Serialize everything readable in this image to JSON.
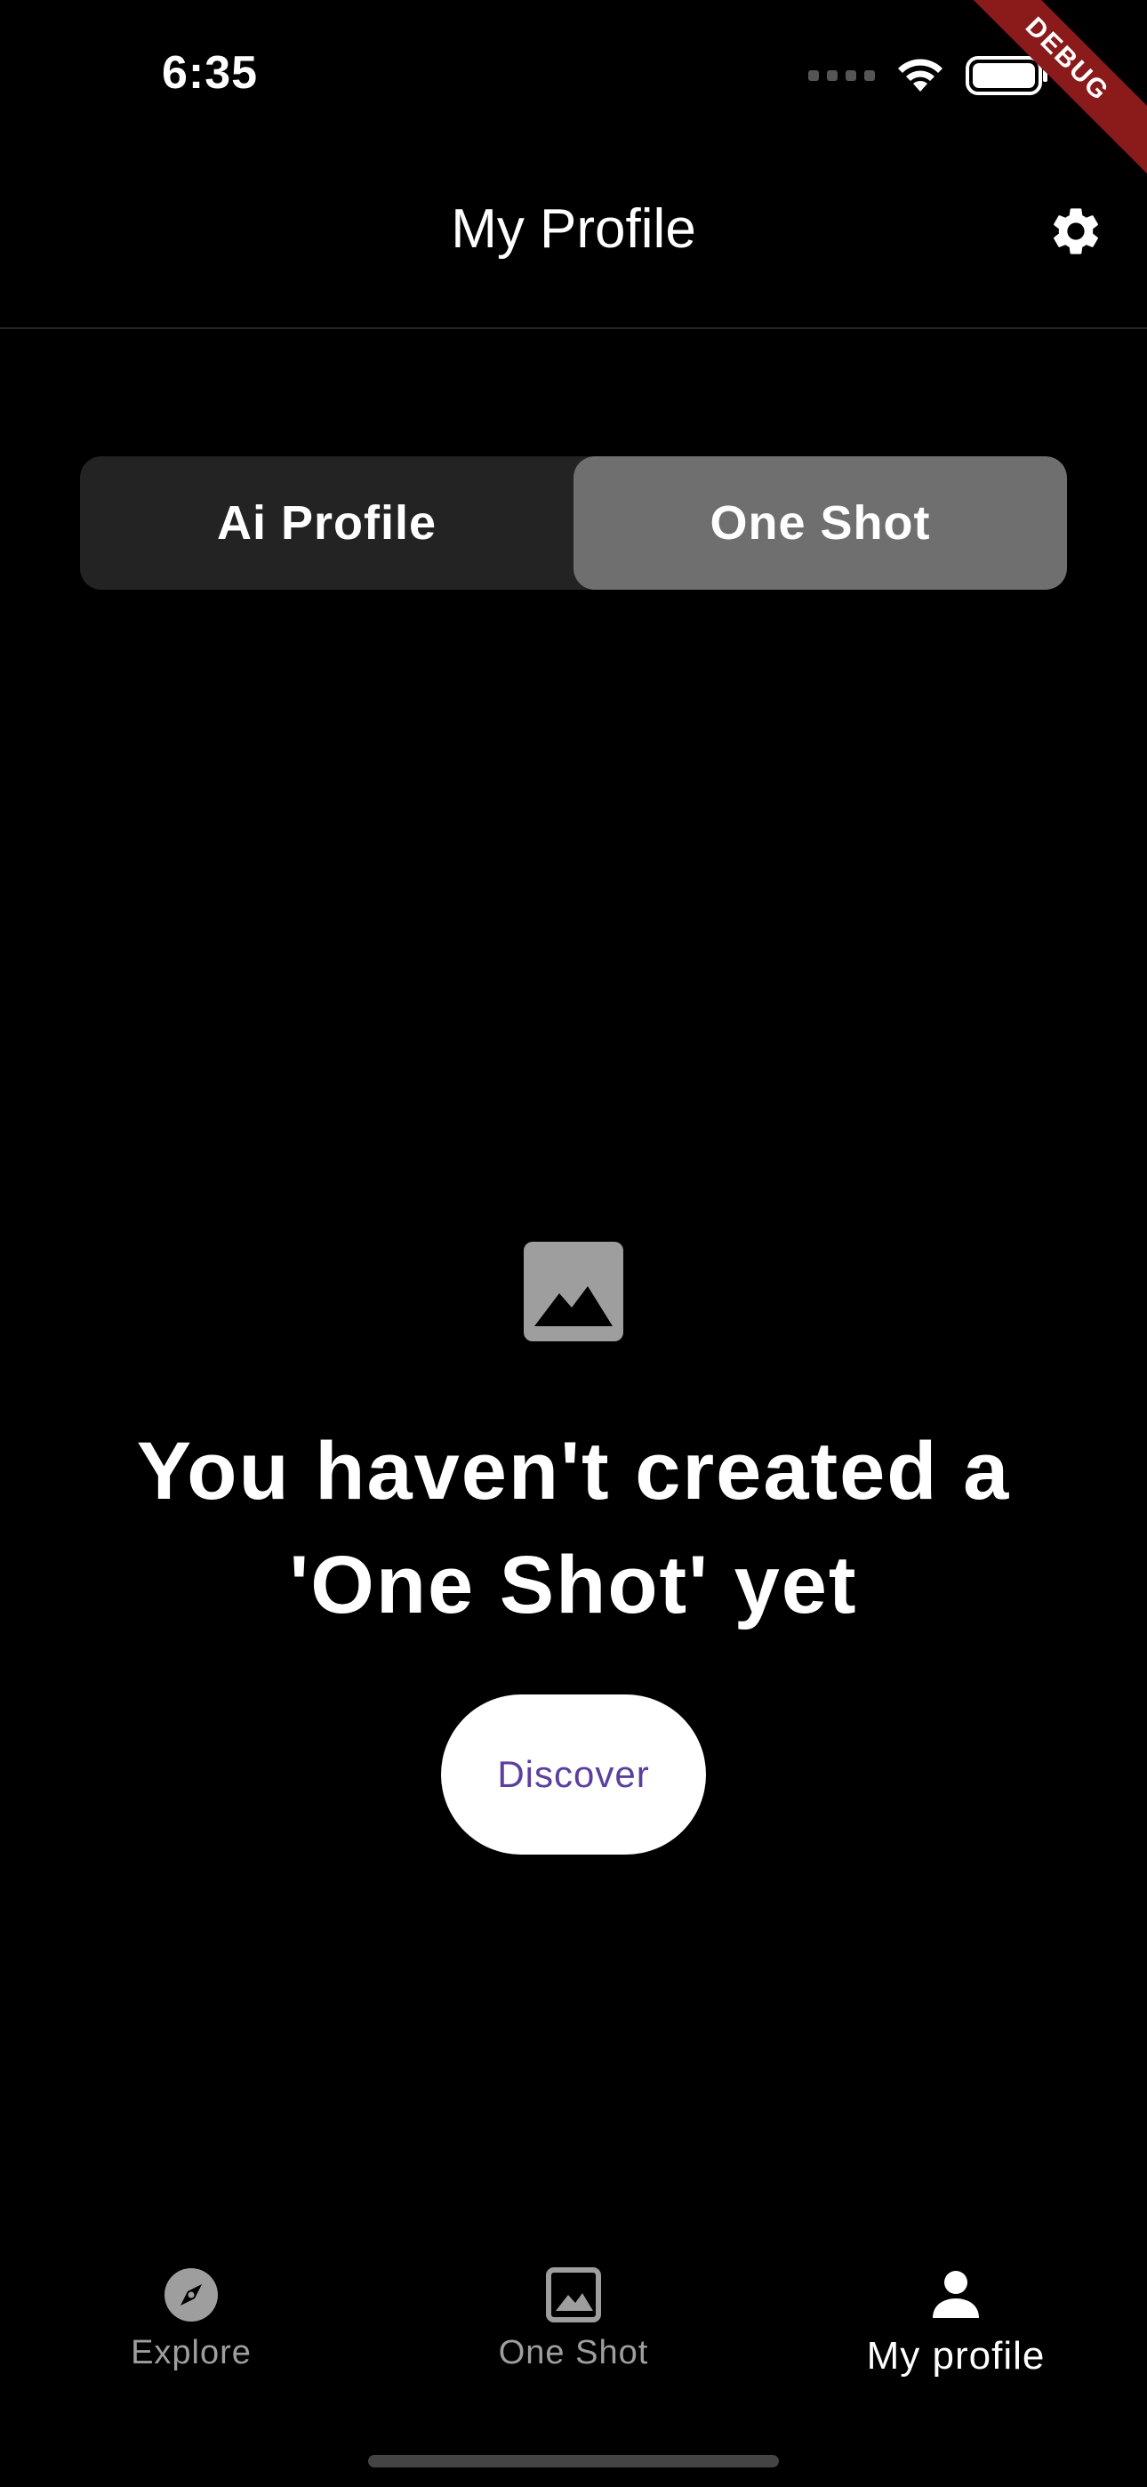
{
  "status_bar": {
    "time": "6:35",
    "debug_label": "DEBUG"
  },
  "header": {
    "title": "My Profile",
    "settings_icon": "gear-icon"
  },
  "tabs": [
    {
      "label": "Ai Profile",
      "active": false
    },
    {
      "label": "One Shot",
      "active": true
    }
  ],
  "empty_state": {
    "icon": "image-icon",
    "message": "You haven't created a 'One Shot' yet",
    "button_label": "Discover"
  },
  "bottom_nav": [
    {
      "label": "Explore",
      "icon": "compass-icon",
      "active": false
    },
    {
      "label": "One Shot",
      "icon": "image-icon",
      "active": false
    },
    {
      "label": "My profile",
      "icon": "person-icon",
      "active": true
    }
  ],
  "colors": {
    "background": "#000000",
    "segment_bg": "#232323",
    "segment_active": "#6f6f6f",
    "button_text": "#5b3fa0",
    "inactive_nav": "#9e9e9e"
  }
}
